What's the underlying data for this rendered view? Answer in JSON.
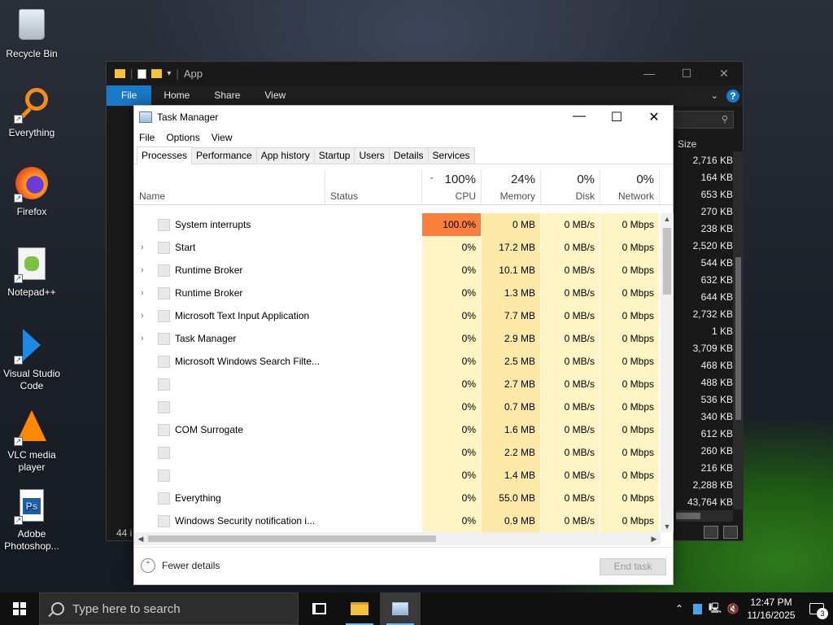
{
  "desktop": {
    "icons": [
      {
        "label": "Recycle Bin",
        "icon": "recycle-bin-icon"
      },
      {
        "label": "Everything",
        "icon": "everything-search-icon"
      },
      {
        "label": "Firefox",
        "icon": "firefox-icon"
      },
      {
        "label": "Notepad++",
        "icon": "notepad-plus-plus-icon"
      },
      {
        "label": "Visual Studio Code",
        "icon": "vscode-icon"
      },
      {
        "label": "VLC media player",
        "icon": "vlc-icon"
      },
      {
        "label": "Adobe Photoshop...",
        "icon": "photoshop-icon"
      }
    ]
  },
  "explorer": {
    "title": "App",
    "ribbon_tabs": [
      "File",
      "Home",
      "Share",
      "View"
    ],
    "size_header": "Size",
    "sizes": [
      "2,716 KB",
      "164 KB",
      "653 KB",
      "270 KB",
      "238 KB",
      "2,520 KB",
      "544 KB",
      "632 KB",
      "644 KB",
      "2,732 KB",
      "1 KB",
      "3,709 KB",
      "468 KB",
      "488 KB",
      "536 KB",
      "340 KB",
      "612 KB",
      "260 KB",
      "216 KB",
      "2,288 KB",
      "43,764 KB"
    ],
    "status": "44 i"
  },
  "taskmanager": {
    "title": "Task Manager",
    "menu": [
      "File",
      "Options",
      "View"
    ],
    "tabs": [
      "Processes",
      "Performance",
      "App history",
      "Startup",
      "Users",
      "Details",
      "Services"
    ],
    "active_tab": "Processes",
    "columns": {
      "name": "Name",
      "status": "Status",
      "cpu": {
        "pct": "100%",
        "label": "CPU"
      },
      "memory": {
        "pct": "24%",
        "label": "Memory"
      },
      "disk": {
        "pct": "0%",
        "label": "Disk"
      },
      "network": {
        "pct": "0%",
        "label": "Network"
      }
    },
    "processes": [
      {
        "name": "System interrupts",
        "expand": false,
        "cpu": "100.0%",
        "mem": "0 MB",
        "disk": "0 MB/s",
        "net": "0 Mbps"
      },
      {
        "name": "Start",
        "expand": true,
        "cpu": "0%",
        "mem": "17.2 MB",
        "disk": "0 MB/s",
        "net": "0 Mbps"
      },
      {
        "name": "Runtime Broker",
        "expand": true,
        "cpu": "0%",
        "mem": "10.1 MB",
        "disk": "0 MB/s",
        "net": "0 Mbps"
      },
      {
        "name": "Runtime Broker",
        "expand": true,
        "cpu": "0%",
        "mem": "1.3 MB",
        "disk": "0 MB/s",
        "net": "0 Mbps"
      },
      {
        "name": "Microsoft Text Input Application",
        "expand": true,
        "cpu": "0%",
        "mem": "7.7 MB",
        "disk": "0 MB/s",
        "net": "0 Mbps"
      },
      {
        "name": "Task Manager",
        "expand": true,
        "cpu": "0%",
        "mem": "2.9 MB",
        "disk": "0 MB/s",
        "net": "0 Mbps"
      },
      {
        "name": "Microsoft Windows Search Filte...",
        "expand": false,
        "cpu": "0%",
        "mem": "2.5 MB",
        "disk": "0 MB/s",
        "net": "0 Mbps"
      },
      {
        "name": "",
        "expand": false,
        "cpu": "0%",
        "mem": "2.7 MB",
        "disk": "0 MB/s",
        "net": "0 Mbps"
      },
      {
        "name": "",
        "expand": false,
        "cpu": "0%",
        "mem": "0.7 MB",
        "disk": "0 MB/s",
        "net": "0 Mbps"
      },
      {
        "name": "COM Surrogate",
        "expand": false,
        "cpu": "0%",
        "mem": "1.6 MB",
        "disk": "0 MB/s",
        "net": "0 Mbps"
      },
      {
        "name": "",
        "expand": false,
        "cpu": "0%",
        "mem": "2.2 MB",
        "disk": "0 MB/s",
        "net": "0 Mbps"
      },
      {
        "name": "",
        "expand": false,
        "cpu": "0%",
        "mem": "1.4 MB",
        "disk": "0 MB/s",
        "net": "0 Mbps"
      },
      {
        "name": "Everything",
        "expand": false,
        "cpu": "0%",
        "mem": "55.0 MB",
        "disk": "0 MB/s",
        "net": "0 Mbps"
      },
      {
        "name": "Windows Security notification i...",
        "expand": false,
        "cpu": "0%",
        "mem": "0.9 MB",
        "disk": "0 MB/s",
        "net": "0 Mbps"
      }
    ],
    "fewer_details": "Fewer details",
    "end_task": "End task"
  },
  "taskbar": {
    "search_placeholder": "Type here to search",
    "time": "12:47 PM",
    "date": "11/16/2025",
    "notification_count": "3"
  },
  "colors": {
    "cpu_hot": "#fa7e3c",
    "cell_bg": "#fff4c4",
    "accent": "#1979ca"
  }
}
